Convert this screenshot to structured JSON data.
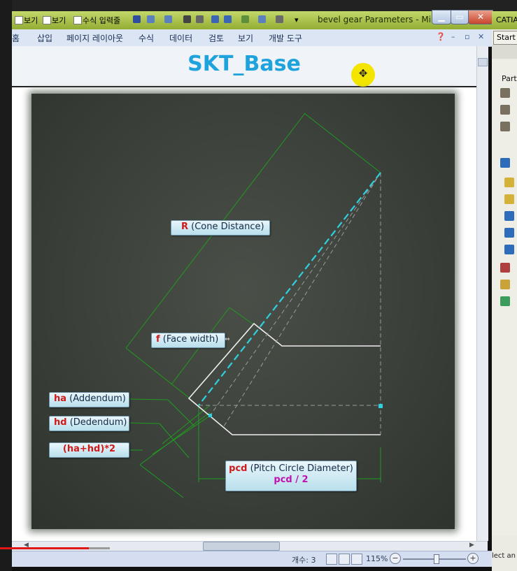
{
  "window": {
    "title": "bevel gear Parameters - Mi...",
    "qat": [
      "보기",
      "보기",
      "수식 입력줄"
    ]
  },
  "ribbon": {
    "tabs": [
      "홈",
      "삽입",
      "페이지 레이아웃",
      "수식",
      "데이터",
      "검토",
      "보기",
      "개발 도구"
    ]
  },
  "sheet": {
    "title": "SKT_Base"
  },
  "labels": {
    "R": {
      "sym": "R",
      "text": " (Cone Distance)"
    },
    "f": {
      "sym": "f",
      "text": " (Face width)"
    },
    "ha": {
      "sym": "ha",
      "text": " (Addendum)"
    },
    "hd": {
      "sym": "hd",
      "text": " (Dedendum)"
    },
    "hahd": {
      "text": "(ha+hd)*2"
    },
    "pcd": {
      "sym": "pcd",
      "text": " (Pitch Circle Diameter)",
      "formula": "pcd / 2"
    }
  },
  "statusbar": {
    "count": "개수: 3",
    "zoom": "115%"
  },
  "catia": {
    "title": "CATIA",
    "start": "Start",
    "tree_label": "Part",
    "bottom_text": "lect an"
  },
  "colors": {
    "title_blue": "#1ea3dc",
    "sketch_green": "#1f9c1f",
    "axis_cyan": "#2fd0e0",
    "label_red": "#d01919",
    "formula_magenta": "#c010b0"
  }
}
